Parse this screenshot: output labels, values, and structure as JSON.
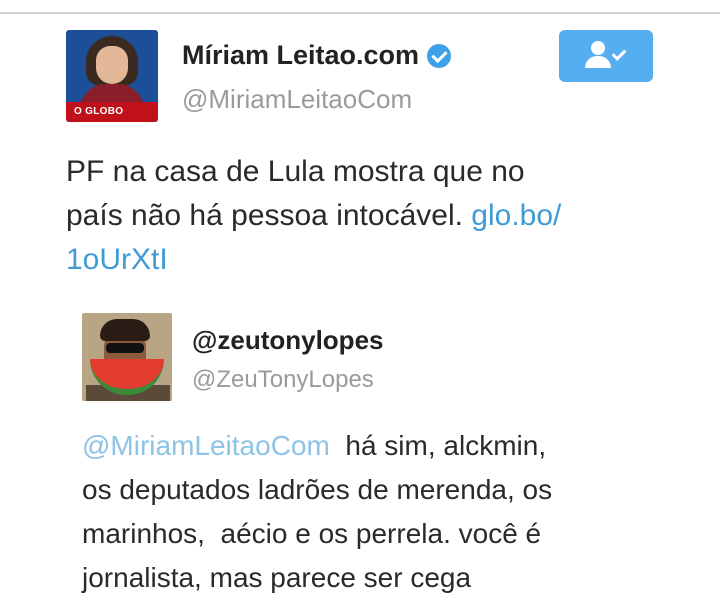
{
  "tweet": {
    "author_name": "Míriam Leitao.com",
    "author_handle": "@MiriamLeitaoCom",
    "avatar_brand": "O GLOBO",
    "verified_icon": "verified-badge-icon",
    "follow_icon": "following-person-check-icon",
    "text_lines": [
      "PF na casa de Lula mostra que no",
      "país não há pessoa intocável. "
    ],
    "link_part1": "glo.bo/",
    "link_part2": "1oUrXtI"
  },
  "quoted": {
    "author_name": "@zeutonylopes",
    "author_handle": "@ZeuTonyLopes",
    "mention": "@MiriamLeitaoCom",
    "line1_rest": "  há sim, alckmin,",
    "line2": "os deputados ladrões de merenda, os",
    "line3": "marinhos,  aécio e os perrela. você é",
    "line4": "jornalista, mas parece ser cega"
  },
  "colors": {
    "link": "#3f9bd4",
    "follow_button": "#55aef0",
    "verified": "#3ea1e8",
    "brand_red": "#c0111b"
  }
}
